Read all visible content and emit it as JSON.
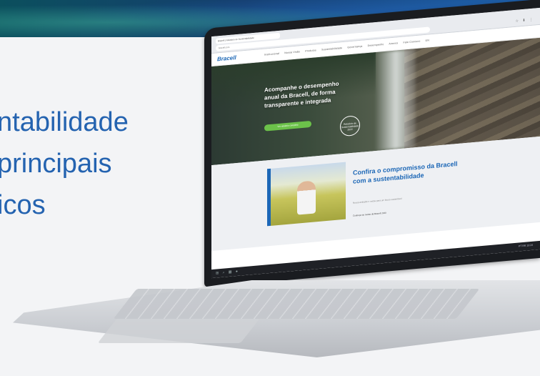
{
  "hero_text": {
    "lines": [
      "ntabilidade",
      "principais",
      "icos"
    ]
  },
  "browser": {
    "tab_title": "Bracell | Relatório de Sustentabilidade",
    "address": "bracell.com",
    "toolbar_icons": "☆ ⬇ ⋮"
  },
  "site": {
    "logo": "Bracell",
    "menu": [
      "Institucional",
      "Nossa Visão",
      "Produtos",
      "Sustentabilidade",
      "Governança",
      "Desempenho",
      "Anexos",
      "Fale Conosco",
      "EN"
    ],
    "hero": {
      "headline": "Acompanhe o desempenho anual da Bracell, de forma transparente e integrada",
      "cta": "Ver relatório completo",
      "badge": "Relatório de Sustentabilidade 2022"
    },
    "section": {
      "title": "Confira o compromisso da Bracell com a sustentabilidade",
      "subtitle": "Nossa ambição e metas para um futuro sustentável",
      "link": "Conheça as metas da Bracell 2030"
    }
  },
  "taskbar": {
    "icons": "⊞ ⌕ ▦ ●",
    "tray": "PT BR 13:24"
  }
}
